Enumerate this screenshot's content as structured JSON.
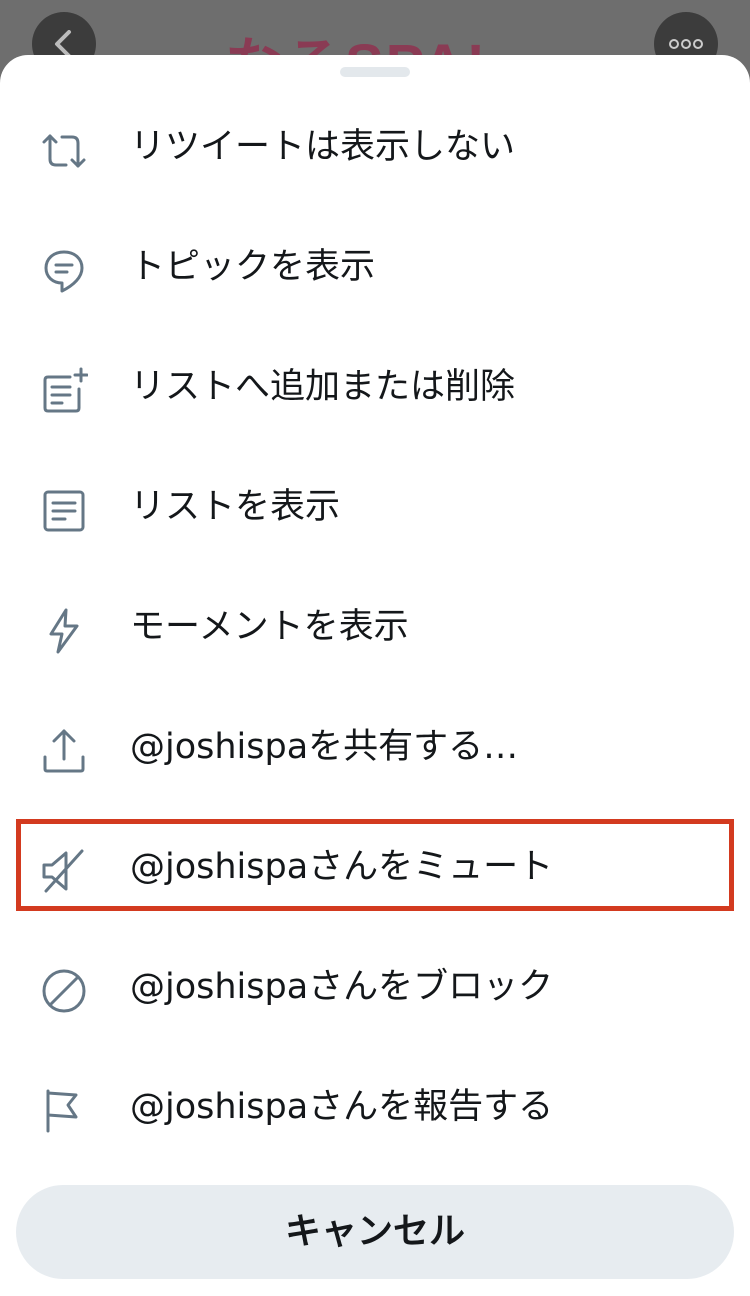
{
  "background": {
    "logo_text": "なるSPA!",
    "back_icon": "chevron-left-icon",
    "more_icon": "ellipsis-icon"
  },
  "menu": {
    "items": [
      {
        "label": "リツイートは表示しない",
        "icon": "retweet-icon"
      },
      {
        "label": "トピックを表示",
        "icon": "topic-icon"
      },
      {
        "label": "リストへ追加または削除",
        "icon": "list-add-icon"
      },
      {
        "label": "リストを表示",
        "icon": "list-icon"
      },
      {
        "label": "モーメントを表示",
        "icon": "lightning-icon"
      },
      {
        "label": "@joshispaを共有する…",
        "icon": "share-icon"
      },
      {
        "label": "@joshispaさんをミュート",
        "icon": "mute-icon",
        "highlighted": true
      },
      {
        "label": "@joshispaさんをブロック",
        "icon": "block-icon"
      },
      {
        "label": "@joshispaさんを報告する",
        "icon": "flag-icon"
      }
    ],
    "cancel_label": "キャンセル"
  },
  "colors": {
    "icon": "#657786",
    "text": "#14171a",
    "highlight": "#d33a1f",
    "cancel_bg": "#e7ecf0"
  }
}
